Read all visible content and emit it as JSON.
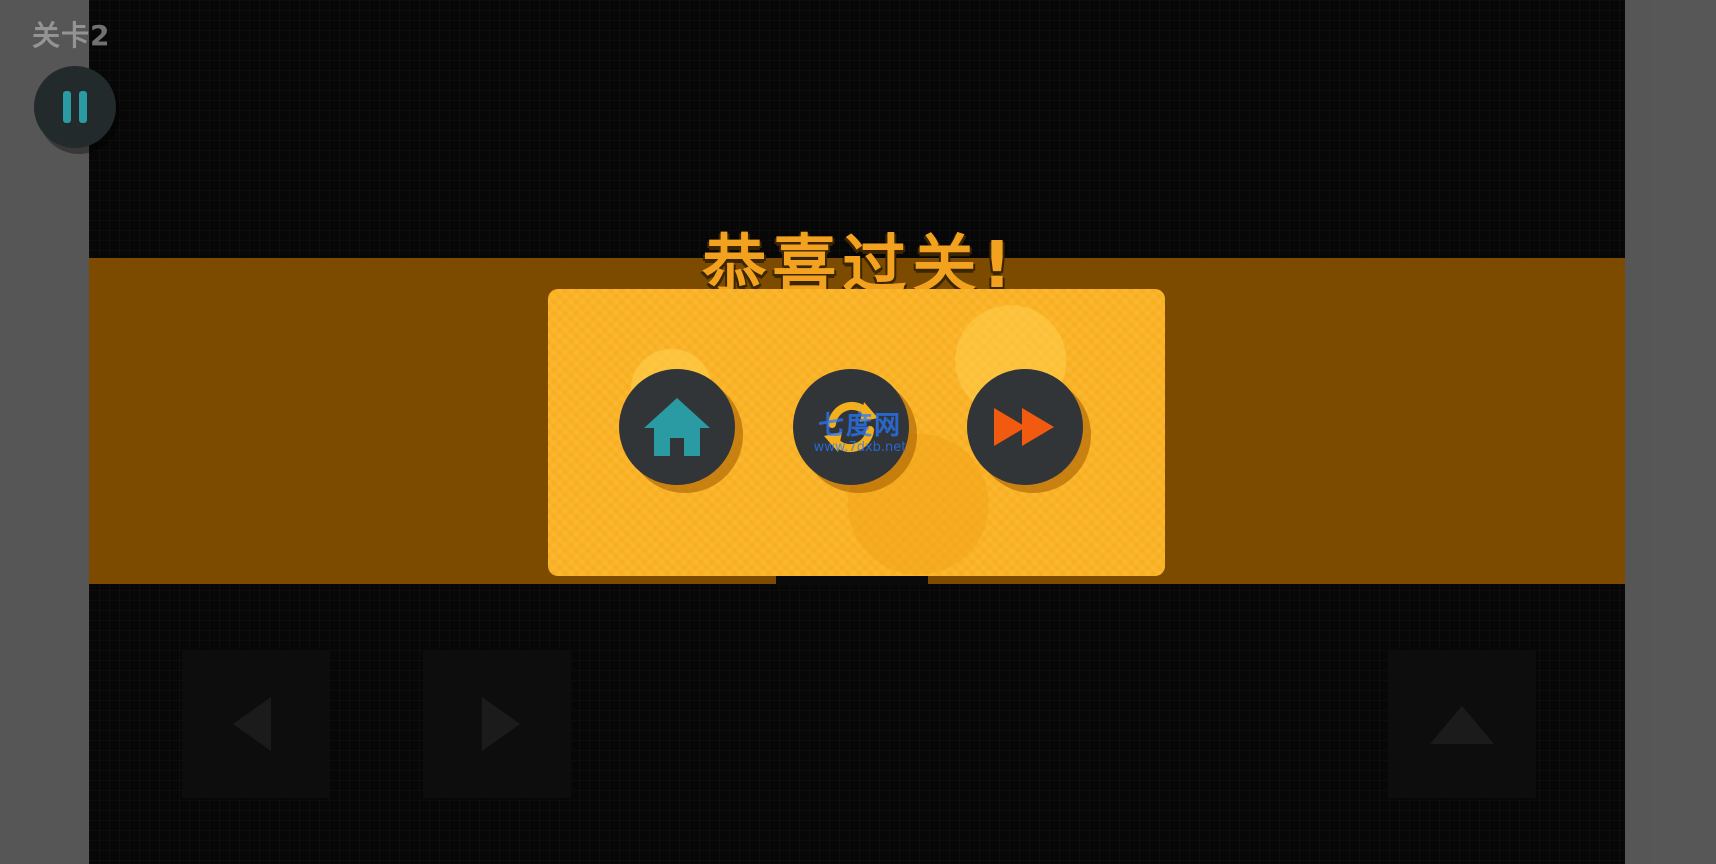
{
  "hud": {
    "level_label": "关卡2",
    "pause_icon": "pause-icon"
  },
  "dialog": {
    "title": "恭喜过关!",
    "buttons": [
      {
        "name": "home",
        "icon": "home-icon",
        "color": "#2a9aa3"
      },
      {
        "name": "restart",
        "icon": "restart-icon",
        "color": "#f2b01e"
      },
      {
        "name": "next",
        "icon": "fast-forward-icon",
        "color": "#f15a0f"
      }
    ],
    "panel_color": "#fbb323",
    "band_color": "#7d4b00",
    "title_color": "#f3a21f"
  },
  "watermark": {
    "main": "七度网",
    "sub": "www.7dxb.net"
  },
  "controls": {
    "left_icon": "left-arrow-icon",
    "right_icon": "right-arrow-icon",
    "jump_icon": "up-arrow-icon"
  }
}
